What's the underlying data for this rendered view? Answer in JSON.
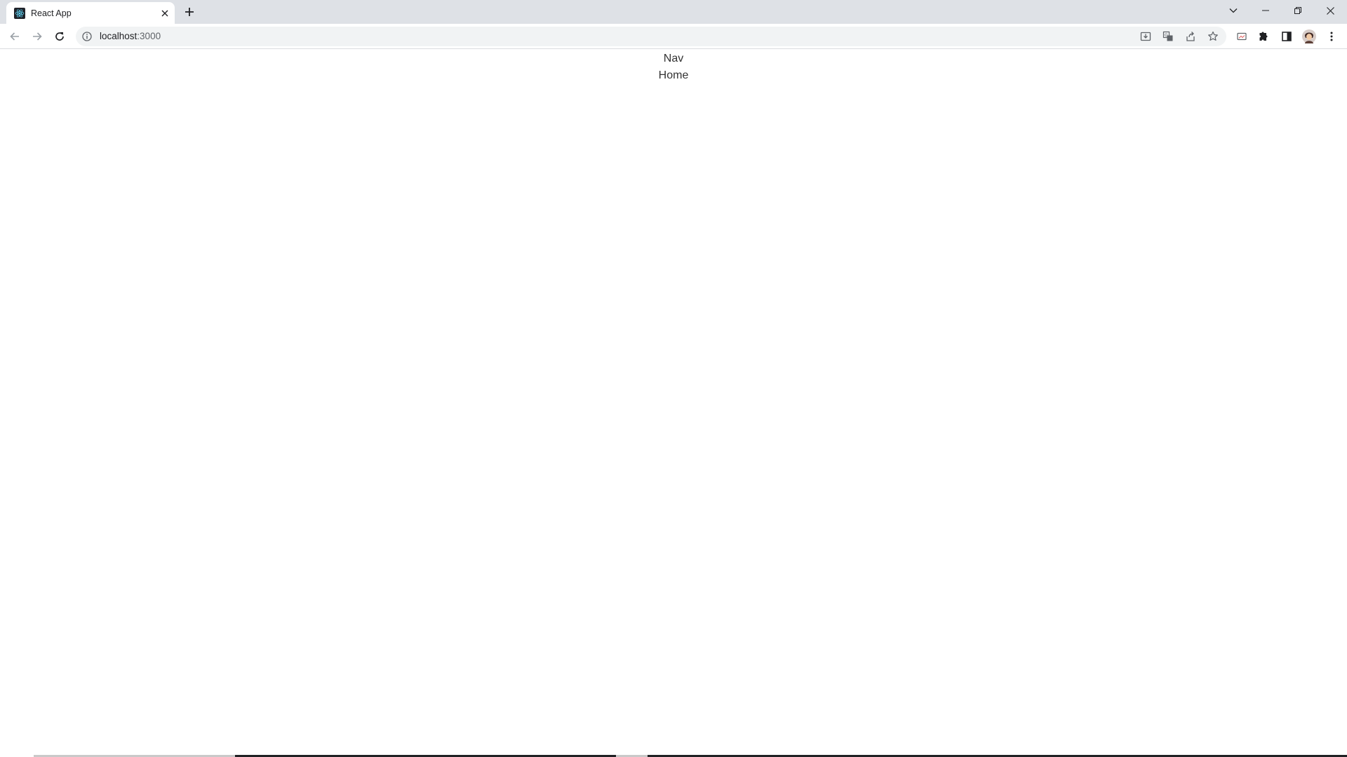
{
  "browser": {
    "tab": {
      "title": "React App",
      "favicon": "react-icon"
    },
    "new_tab_icon": "plus-icon",
    "window_controls": [
      "chevron-down-icon",
      "minimize-icon",
      "restore-icon",
      "close-icon"
    ],
    "url": {
      "host": "localhost",
      "port": ":3000"
    },
    "omnibox_icons": [
      "install-app-icon",
      "translate-icon",
      "share-icon",
      "bookmark-star-icon"
    ],
    "toolbar_icons": [
      "media-cast-icon",
      "extensions-icon",
      "side-panel-icon",
      "profile-avatar",
      "more-menu-icon"
    ],
    "colors": {
      "tabstrip": "#dee1e6",
      "omnibox": "#f1f3f4",
      "react_blue": "#61dafb"
    }
  },
  "page": {
    "nav_text": "Nav",
    "home_text": "Home"
  }
}
